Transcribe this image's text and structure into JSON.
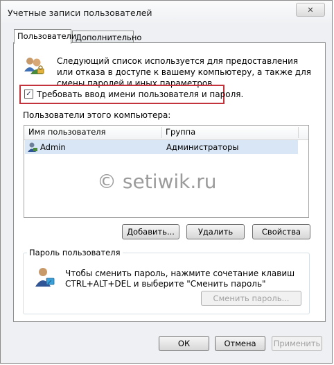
{
  "window": {
    "title": "Учетные записи пользователей",
    "close_symbol": "✕"
  },
  "tabs": [
    {
      "label": "Пользователи",
      "active": true
    },
    {
      "label": "Дополнительно",
      "active": false
    }
  ],
  "users_tab": {
    "description": "Следующий список используется для предоставления или отказа в доступе к вашему компьютеру, а также для смены паролей и иных параметров.",
    "require_login": {
      "label": "Требовать ввод имени пользователя и пароля.",
      "checked": true,
      "check_glyph": "✓"
    },
    "users_label": "Пользователи этого компьютера:",
    "table": {
      "columns": [
        "Имя пользователя",
        "Группа"
      ],
      "rows": [
        {
          "name": "Admin",
          "group": "Администраторы",
          "selected": true
        }
      ]
    },
    "buttons": {
      "add": "Добавить...",
      "remove": "Удалить",
      "properties": "Свойства"
    },
    "password_group": {
      "title": "Пароль пользователя",
      "text_line1": "Чтобы сменить пароль, нажмите сочетание клавиш",
      "text_line2": "CTRL+ALT+DEL и выберите \"Сменить пароль\"",
      "button": "Сменить пароль..."
    }
  },
  "dialog_buttons": {
    "ok": "ОК",
    "cancel": "Отмена",
    "apply": "Применить"
  },
  "watermark": "© setiwik.ru",
  "colors": {
    "highlight_border": "#c4333b",
    "selection": "#d9e6f5"
  },
  "icons": [
    "users-icon",
    "user-icon",
    "user-key-icon",
    "close-icon",
    "checkmark-icon"
  ]
}
